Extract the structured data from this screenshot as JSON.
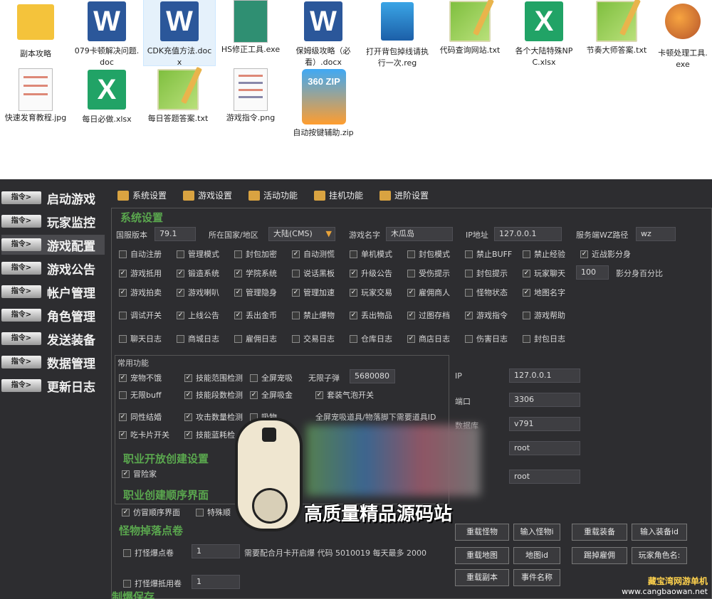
{
  "explorer": {
    "files": [
      {
        "name": "副本攻略",
        "icon": "folder-icon"
      },
      {
        "name": "079卡顿解决问题.doc",
        "icon": "word-icon"
      },
      {
        "name": "CDK充值方法.docx",
        "icon": "word-icon"
      },
      {
        "name": "HS修正工具.exe",
        "icon": "app-icon"
      },
      {
        "name": "保姆级攻略（必看）.docx",
        "icon": "word-icon"
      },
      {
        "name": "打开背包掉线请执行一次.reg",
        "icon": "registry-icon"
      },
      {
        "name": "代码查询网站.txt",
        "icon": "notepad-icon"
      },
      {
        "name": "各个大陆特殊NPC.xlsx",
        "icon": "excel-icon"
      },
      {
        "name": "节奏大师答案.txt",
        "icon": "notepad-icon"
      },
      {
        "name": "卡顿处理工具.exe",
        "icon": "exe-icon"
      },
      {
        "name": "快速发育教程.jpg",
        "icon": "image-icon"
      },
      {
        "name": "每日必做.xlsx",
        "icon": "excel-icon"
      },
      {
        "name": "每日答题答案.txt",
        "icon": "notepad-icon"
      },
      {
        "name": "游戏指令.png",
        "icon": "image-icon"
      },
      {
        "name": "自动按键辅助.zip",
        "icon": "zip-icon"
      }
    ],
    "word_letter": "W",
    "excel_letter": "X",
    "zip_label": "360 ZIP"
  },
  "sidebar": {
    "tag": "指令>",
    "items": [
      "启动游戏",
      "玩家监控",
      "游戏配置",
      "游戏公告",
      "帐户管理",
      "角色管理",
      "发送装备",
      "数据管理",
      "更新日志"
    ]
  },
  "tabs": [
    "系统设置",
    "游戏设置",
    "活动功能",
    "挂机功能",
    "进阶设置"
  ],
  "system": {
    "title": "系统设置",
    "version_label": "国服版本",
    "version_value": "79.1",
    "country_label": "所在国家/地区",
    "country_value": "大陆(CMS)",
    "game_name_label": "游戏名字",
    "game_name_value": "木瓜岛",
    "ip_label": "IP地址",
    "ip_value": "127.0.0.1",
    "wz_label": "服务端WZ路径",
    "wz_value": "wz",
    "row1": [
      [
        "自动注册",
        false
      ],
      [
        "管理模式",
        false
      ],
      [
        "封包加密",
        false
      ],
      [
        "自动测慌",
        true
      ],
      [
        "单机模式",
        false
      ],
      [
        "封包模式",
        false
      ],
      [
        "禁止BUFF",
        false
      ],
      [
        "禁止经验",
        false
      ],
      [
        "近战影分身",
        true
      ]
    ],
    "row2": [
      [
        "游戏抵用",
        true
      ],
      [
        "锻造系统",
        true
      ],
      [
        "学院系统",
        true
      ],
      [
        "说话黑板",
        false
      ],
      [
        "升级公告",
        true
      ],
      [
        "受伤提示",
        false
      ],
      [
        "封包提示",
        false
      ],
      [
        "玩家聊天",
        true
      ]
    ],
    "row2_value": "100",
    "row2_tail": "影分身百分比",
    "row3": [
      [
        "游戏拍卖",
        true
      ],
      [
        "游戏喇叭",
        true
      ],
      [
        "管理隐身",
        true
      ],
      [
        "管理加速",
        true
      ],
      [
        "玩家交易",
        true
      ],
      [
        "雇佣商人",
        true
      ],
      [
        "怪物状态",
        false
      ],
      [
        "地图名字",
        true
      ]
    ],
    "row4": [
      [
        "调试开关",
        false
      ],
      [
        "上线公告",
        true
      ],
      [
        "丢出金币",
        true
      ],
      [
        "禁止爆物",
        false
      ],
      [
        "丢出物品",
        true
      ],
      [
        "过图存档",
        true
      ],
      [
        "游戏指令",
        true
      ],
      [
        "游戏帮助",
        false
      ]
    ],
    "row5": [
      [
        "聊天日志",
        false
      ],
      [
        "商城日志",
        false
      ],
      [
        "雇佣日志",
        false
      ],
      [
        "交易日志",
        false
      ],
      [
        "仓库日志",
        false
      ],
      [
        "商店日志",
        true
      ],
      [
        "伤害日志",
        false
      ],
      [
        "封包日志",
        false
      ]
    ]
  },
  "common": {
    "title": "常用功能",
    "r1": [
      [
        "宠物不饿",
        true
      ],
      [
        "技能范围检测",
        true
      ],
      [
        "全屏宠吸",
        false
      ]
    ],
    "unlimited_label": "无限子弹",
    "unlimited_value": "5680080",
    "r2": [
      [
        "无限buff",
        false
      ],
      [
        "技能段数检测",
        true
      ],
      [
        "全屏吸金",
        true
      ],
      [
        "套装气泡开关",
        true
      ]
    ],
    "r3": [
      [
        "同性结婚",
        true
      ],
      [
        "攻击数量检测",
        true
      ],
      [
        "吸物",
        false
      ]
    ],
    "r3_note": "全屏宠吸道具/物落脚下需要道具ID",
    "r4": [
      [
        "吃卡片开关",
        true
      ],
      [
        "技能蓝耗检",
        true
      ]
    ]
  },
  "db": {
    "ip_label": "IP",
    "ip_value": "127.0.0.1",
    "port_label": "端口",
    "port_value": "3306",
    "db_label": "数据库",
    "db_value": "v791",
    "user_value": "root",
    "pass_value": "root"
  },
  "job_open": {
    "title": "职业开放创建设置",
    "item": "冒险家"
  },
  "job_order": {
    "title": "职业创建顺序界面",
    "items": [
      "仿冒顺序界面",
      "特殊顺"
    ]
  },
  "drops": {
    "title": "怪物掉落点卷",
    "r1_label": "打怪爆点卷",
    "r1_value": "1",
    "r1_note": "需要配合月卡开启爆 代码 5010019 每天最多 2000",
    "r2_label": "打怪爆抵用卷",
    "r2_value": "1",
    "bottom_title": "制爆保存"
  },
  "buttons": [
    "重载怪物",
    "输入怪物i",
    "重载装备",
    "输入装备id",
    "重载地图",
    "地图id",
    "踢掉雇佣",
    "玩家角色名:",
    "重载副本",
    "事件名称"
  ],
  "overlay_text": "高质量精品源码站",
  "watermark": {
    "line1": "藏宝湾网游单机",
    "line2": "www.cangbaowan.net"
  },
  "colors": {
    "panel": "#2d2d30",
    "section_green": "#5aa74e",
    "word_blue": "#2b579a",
    "excel_green": "#21a366"
  }
}
